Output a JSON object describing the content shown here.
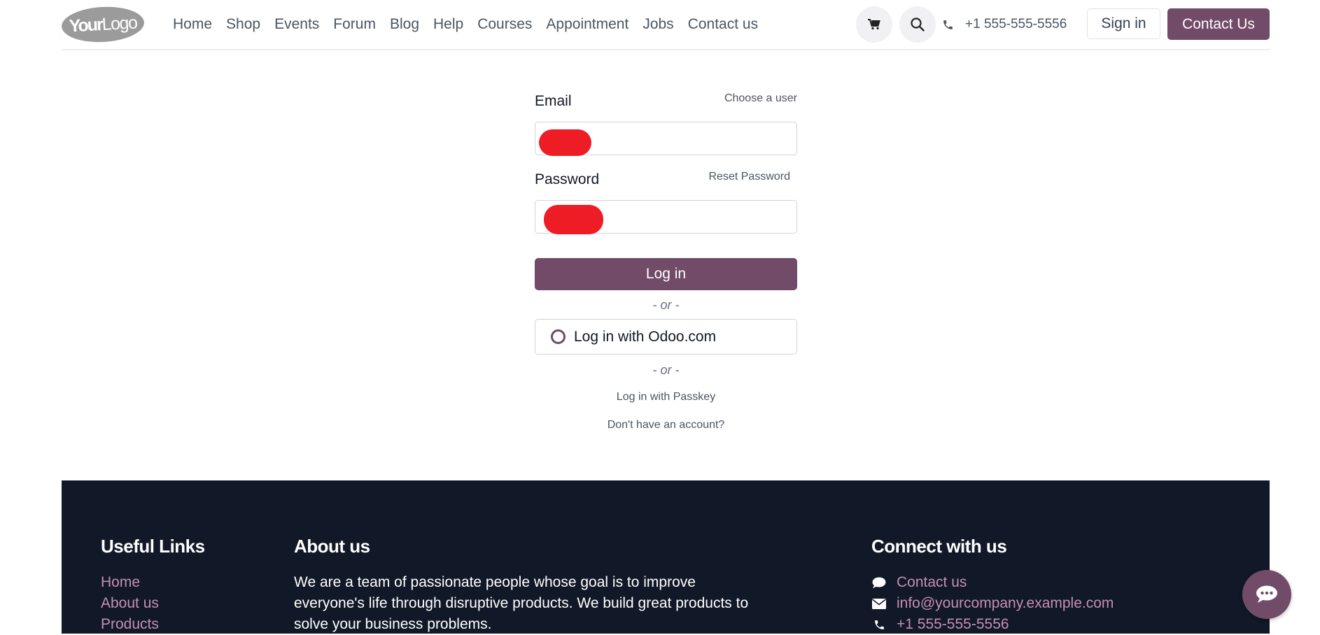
{
  "header": {
    "logo_text_bold": "Your",
    "logo_text_regular": "Logo",
    "nav": [
      "Home",
      "Shop",
      "Events",
      "Forum",
      "Blog",
      "Help",
      "Courses",
      "Appointment",
      "Jobs",
      "Contact us"
    ],
    "phone": "+1 555-555-5556",
    "sign_in": "Sign in",
    "contact_us": "Contact Us"
  },
  "login": {
    "email_label": "Email",
    "choose_user": "Choose a user",
    "password_label": "Password",
    "reset_password": "Reset Password",
    "login_button": "Log in",
    "or_text": "- or -",
    "oauth_label": "Log in with Odoo.com",
    "passkey": "Log in with Passkey",
    "signup": "Don't have an account?"
  },
  "footer": {
    "useful_links_title": "Useful Links",
    "useful_links": [
      "Home",
      "About us",
      "Products"
    ],
    "about_title": "About us",
    "about_text": "We are a team of passionate people whose goal is to improve everyone's life through disruptive products. We build great products to solve your business problems.",
    "connect_title": "Connect with us",
    "connect_contact": "Contact us",
    "connect_email": "info@yourcompany.example.com",
    "connect_phone": "+1 555-555-5556"
  },
  "colors": {
    "brand": "#714b67",
    "footer_bg": "#111827",
    "footer_link": "#c48fb4",
    "redaction": "#ee1c25"
  }
}
